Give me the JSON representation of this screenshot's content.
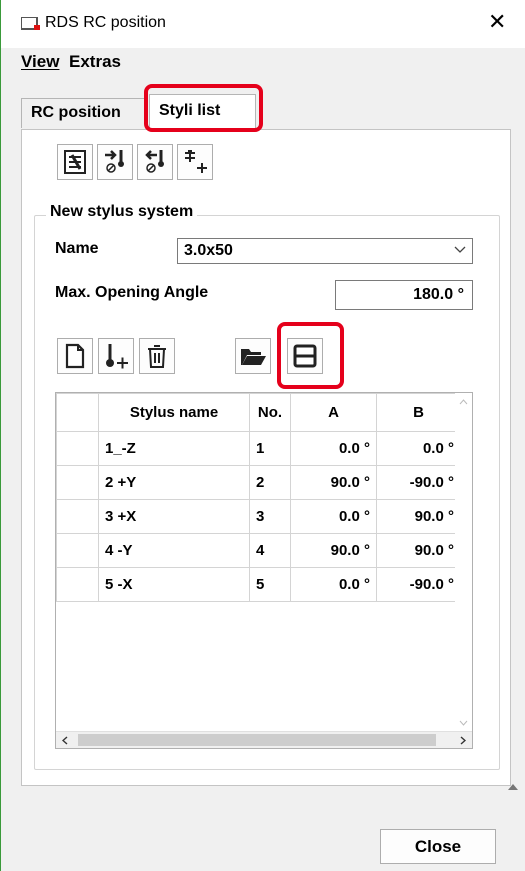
{
  "window": {
    "title": "RDS RC position",
    "close_glyph": "✕"
  },
  "menu": {
    "view": "View",
    "extras": "Extras"
  },
  "tabs": [
    {
      "label": "RC position"
    },
    {
      "label": "Styli list"
    }
  ],
  "toolbar_icons": [
    "list-edit-icon",
    "import-stylus-icon",
    "export-stylus-icon",
    "add-tree-icon"
  ],
  "group": {
    "title": "New stylus system",
    "name_label": "Name",
    "name_value": "3.0x50",
    "angle_label": "Max. Opening Angle",
    "angle_value": "180.0 °"
  },
  "grid_toolbar_icons": [
    "new-document-icon",
    "add-stylus-icon",
    "delete-icon",
    "open-folder-icon",
    "save-icon"
  ],
  "grid": {
    "headers": [
      "Stylus name",
      "No.",
      "A",
      "B"
    ],
    "rows": [
      {
        "name": "1_-Z",
        "no": "1",
        "a": "0.0 °",
        "b": "0.0 °"
      },
      {
        "name": "2 +Y",
        "no": "2",
        "a": "90.0 °",
        "b": "-90.0 °"
      },
      {
        "name": "3 +X",
        "no": "3",
        "a": "0.0 °",
        "b": "90.0 °"
      },
      {
        "name": "4 -Y",
        "no": "4",
        "a": "90.0 °",
        "b": "90.0 °"
      },
      {
        "name": "5 -X",
        "no": "5",
        "a": "0.0 °",
        "b": "-90.0 °"
      }
    ]
  },
  "footer": {
    "close_label": "Close"
  },
  "colors": {
    "highlight": "#e5001b",
    "accent_window": "#3a9a3a"
  }
}
